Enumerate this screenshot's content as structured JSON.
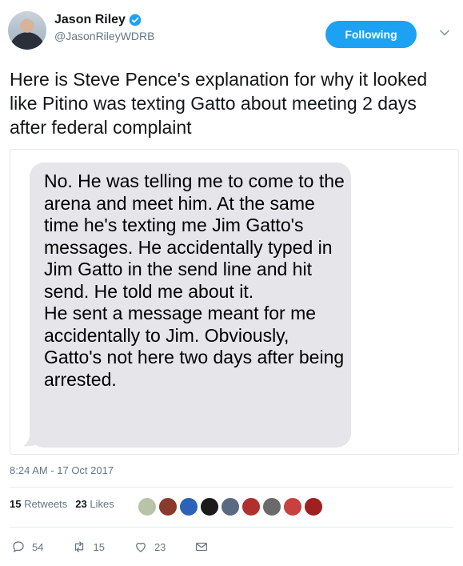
{
  "author": {
    "display_name": "Jason Riley",
    "handle": "@JasonRileyWDRB",
    "verified_icon": "verified-badge-icon"
  },
  "follow_button": {
    "label": "Following"
  },
  "tweet": {
    "text": "Here is Steve Pence's explanation for why it looked like Pitino was texting Gatto about meeting 2 days after federal complaint"
  },
  "media": {
    "bubble_text": "No. He was telling me to come to the arena and meet him. At the same time he's texting me Jim Gatto's messages. He accidentally typed in Jim Gatto in the send line and hit send. He told me about it.\nHe sent a message meant for me accidentally to Jim. Obviously, Gatto's not here two days after being arrested."
  },
  "timestamp": "8:24 AM - 17 Oct 2017",
  "stats": {
    "retweets_count": "15",
    "retweets_label": "Retweets",
    "likes_count": "23",
    "likes_label": "Likes"
  },
  "likers_colors": [
    "#b8c4a8",
    "#8a3a2a",
    "#2a63b8",
    "#1b1b1b",
    "#5a6a80",
    "#b03030",
    "#6a6a6a",
    "#c84040",
    "#a02020"
  ],
  "actions": {
    "reply_count": "54",
    "retweet_count": "15",
    "like_count": "23"
  },
  "colors": {
    "accent": "#1da1f2",
    "muted": "#657786",
    "bubble": "#e5e5ea"
  }
}
